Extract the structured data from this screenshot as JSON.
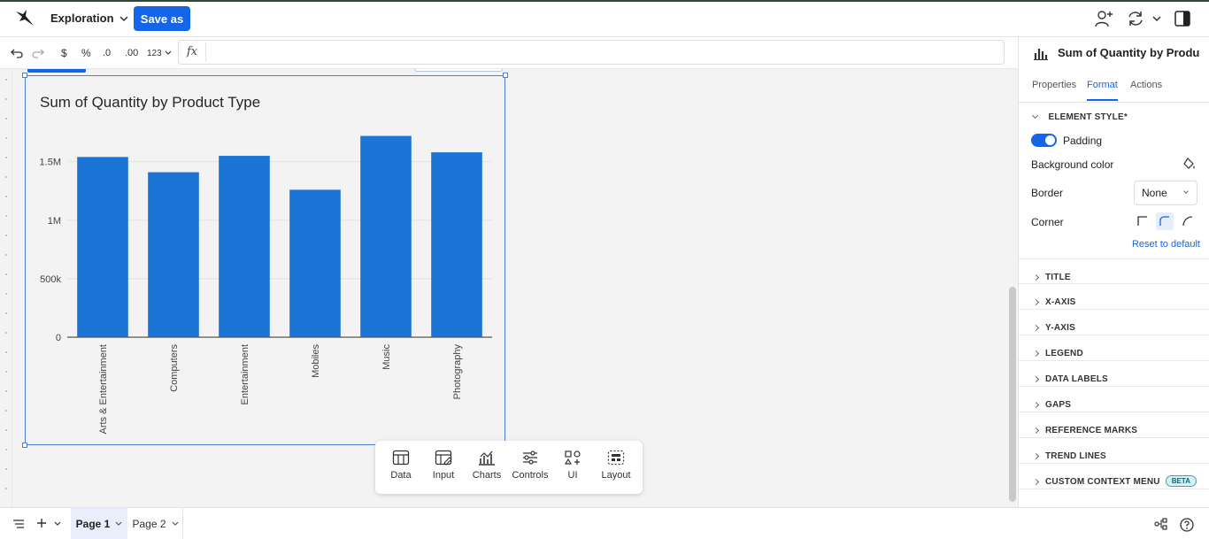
{
  "header": {
    "workbook_title": "Exploration",
    "save_as_label": "Save as"
  },
  "toolbar": {
    "currency_label": "$",
    "percent_label": "%",
    "decimal_decrease_label": ".0",
    "decimal_increase_label": ".00",
    "number_format_label": "123",
    "formula_symbol": "fx",
    "formula_value": ""
  },
  "colors": {
    "accent": "#1565e8",
    "bar_fill": "#1a75d6",
    "canvas_bg": "#f3f3f3"
  },
  "chart_data": {
    "type": "bar",
    "title": "Sum of Quantity by Product Type",
    "categories": [
      "Arts & Entertainment",
      "Computers",
      "Entertainment",
      "Mobiles",
      "Music",
      "Photography"
    ],
    "values": [
      1540000,
      1410000,
      1550000,
      1260000,
      1720000,
      1580000
    ],
    "yticks": [
      0,
      500000,
      1000000,
      1500000
    ],
    "ytick_labels": [
      "0",
      "500k",
      "1M",
      "1.5M"
    ],
    "ylim": [
      0,
      1800000
    ],
    "xlabel": "",
    "ylabel": "",
    "grid": true
  },
  "dock": {
    "items": [
      {
        "label": "Data",
        "icon": "table-icon"
      },
      {
        "label": "Input",
        "icon": "input-icon"
      },
      {
        "label": "Charts",
        "icon": "charts-icon"
      },
      {
        "label": "Controls",
        "icon": "sliders-icon"
      },
      {
        "label": "UI",
        "icon": "shapes-icon"
      },
      {
        "label": "Layout",
        "icon": "layout-icon"
      }
    ]
  },
  "panel": {
    "title": "Sum of Quantity by Produ…",
    "tabs": [
      "Properties",
      "Format",
      "Actions"
    ],
    "active_tab": "Format",
    "element_style": {
      "label": "ELEMENT STYLE*",
      "padding_label": "Padding",
      "padding_on": true,
      "background_label": "Background color",
      "border_label": "Border",
      "border_value": "None",
      "corner_label": "Corner",
      "reset_label": "Reset to default"
    },
    "sections": [
      "TITLE",
      "X-AXIS",
      "Y-AXIS",
      "LEGEND",
      "DATA LABELS",
      "GAPS",
      "REFERENCE MARKS",
      "TREND LINES",
      "CUSTOM CONTEXT MENU"
    ],
    "beta_label": "BETA"
  },
  "pages": {
    "tabs": [
      "Page 1",
      "Page 2"
    ],
    "active": "Page 1"
  }
}
